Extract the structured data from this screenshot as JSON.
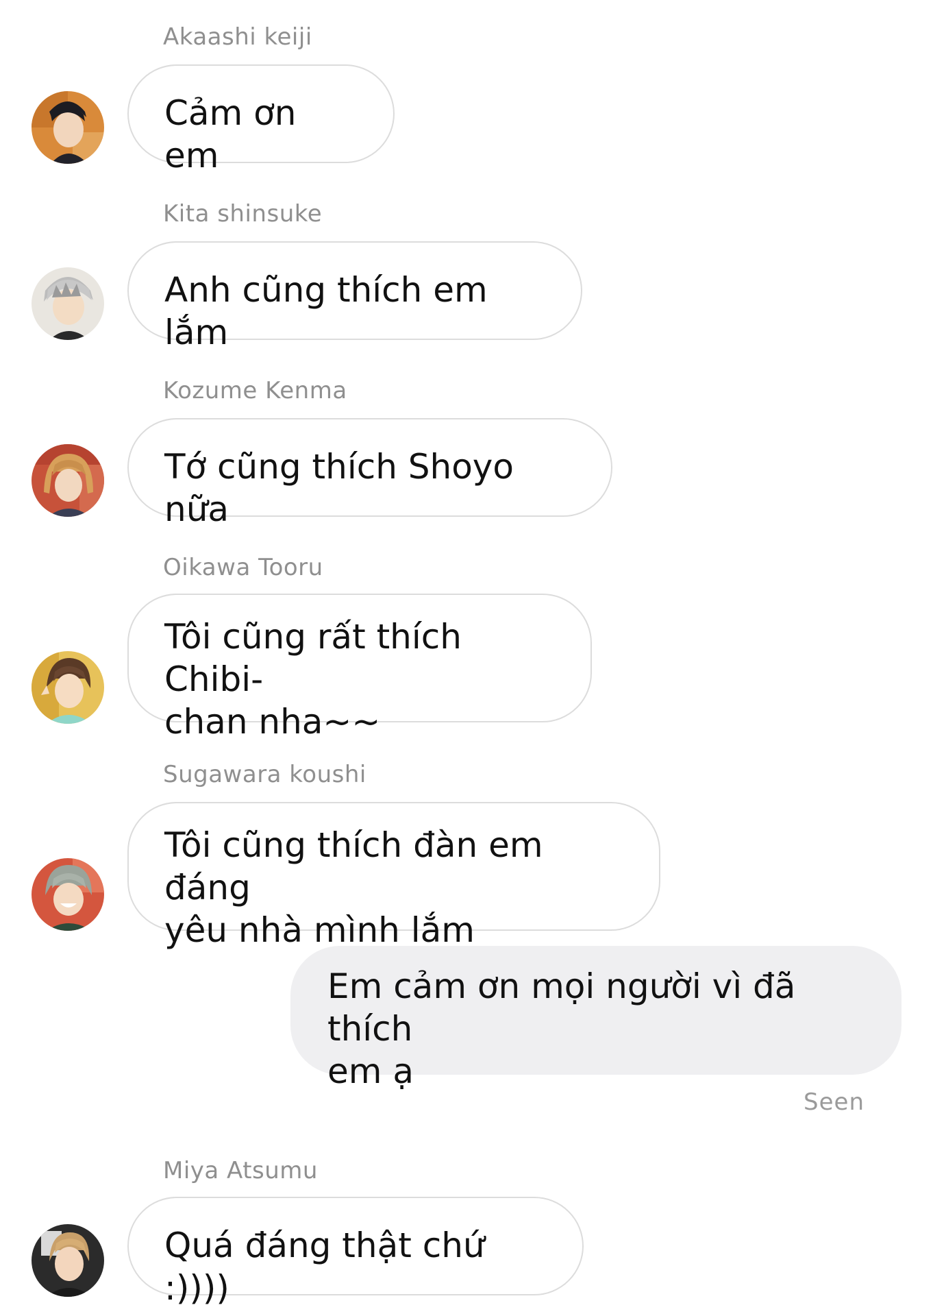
{
  "conversation": {
    "messages": [
      {
        "sender": "Akaashi keiji",
        "avatar": "avatar-akaashi",
        "text": "Cảm ơn em"
      },
      {
        "sender": "Kita shinsuke",
        "avatar": "avatar-kita",
        "text": "Anh cũng thích em lắm"
      },
      {
        "sender": "Kozume Kenma",
        "avatar": "avatar-kenma",
        "text": "Tớ cũng thích Shoyo nữa"
      },
      {
        "sender": "Oikawa Tooru",
        "avatar": "avatar-oikawa",
        "text": "Tôi cũng rất thích Chibi-\nchan nha~~"
      },
      {
        "sender": "Sugawara koushi",
        "avatar": "avatar-sugawara",
        "text": "Tôi cũng thích đàn em đáng\nyêu nhà mình lắm"
      }
    ],
    "my_message": {
      "text": "Em cảm ơn mọi người vì đã thích\nem ạ",
      "status": "Seen"
    },
    "last_message": {
      "sender": "Miya Atsumu",
      "avatar": "avatar-atsumu",
      "text": "Quá đáng thật chứ :))))"
    }
  },
  "colors": {
    "incoming_bubble_border": "#dcdcdc",
    "outgoing_bubble_bg": "#efeff1",
    "sender_name": "#8f8f8f",
    "message_text": "#111111"
  }
}
